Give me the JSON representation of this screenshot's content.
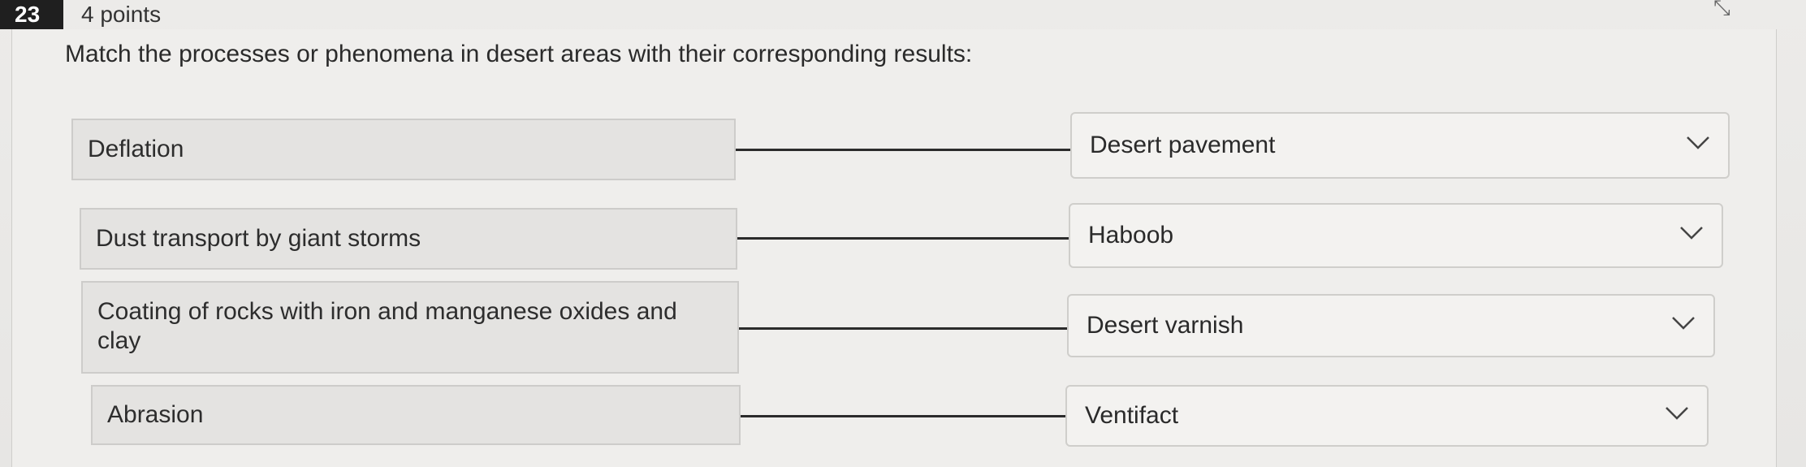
{
  "question": {
    "number": "23",
    "points": "4 points",
    "prompt": "Match the processes or phenomena in desert areas with their corresponding results:"
  },
  "pairs": [
    {
      "term": "Deflation",
      "selected": "Desert pavement"
    },
    {
      "term": "Dust transport by giant storms",
      "selected": "Haboob"
    },
    {
      "term": "Coating of rocks with iron and manganese oxides and clay",
      "selected": "Desert varnish"
    },
    {
      "term": "Abrasion",
      "selected": "Ventifact"
    }
  ],
  "icons": {
    "dropdown": "chevron-down-icon",
    "corner": "expand-icon"
  },
  "colors": {
    "badge_bg": "#1f1f1f",
    "connector": "#2b2b2b"
  }
}
